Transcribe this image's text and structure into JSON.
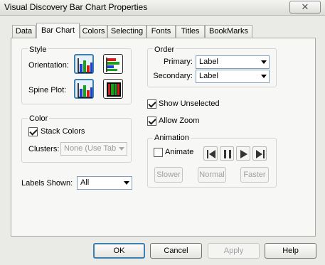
{
  "window": {
    "title": "Visual Discovery Bar Chart Properties",
    "close_glyph": "✕"
  },
  "tabs": [
    {
      "label": "Data"
    },
    {
      "label": "Bar Chart"
    },
    {
      "label": "Colors"
    },
    {
      "label": "Selecting"
    },
    {
      "label": "Fonts"
    },
    {
      "label": "Titles"
    },
    {
      "label": "BookMarks"
    }
  ],
  "active_tab": "Bar Chart",
  "style_group": {
    "title": "Style",
    "orientation_label": "Orientation:",
    "spine_plot_label": "Spine Plot:"
  },
  "order_group": {
    "title": "Order",
    "primary_label": "Primary:",
    "primary_value": "Label",
    "secondary_label": "Secondary:",
    "secondary_value": "Label"
  },
  "options": {
    "show_unselected_label": "Show Unselected",
    "show_unselected_checked": true,
    "allow_zoom_label": "Allow Zoom",
    "allow_zoom_checked": true
  },
  "color_group": {
    "title": "Color",
    "stack_colors_label": "Stack Colors",
    "stack_colors_checked": true,
    "clusters_label": "Clusters:",
    "clusters_value": "None (Use Tab"
  },
  "labels_shown": {
    "label": "Labels Shown:",
    "value": "All"
  },
  "animation_group": {
    "title": "Animation",
    "animate_label": "Animate",
    "animate_checked": false,
    "slower_label": "Slower",
    "normal_label": "Normal",
    "faster_label": "Faster"
  },
  "buttons": {
    "ok": "OK",
    "cancel": "Cancel",
    "apply": "Apply",
    "help": "Help"
  },
  "colors": {
    "accent": "#3c7fb1",
    "bar_blue": "#1f3fcf",
    "bar_green": "#1aa21a",
    "bar_red": "#d21c1c"
  }
}
